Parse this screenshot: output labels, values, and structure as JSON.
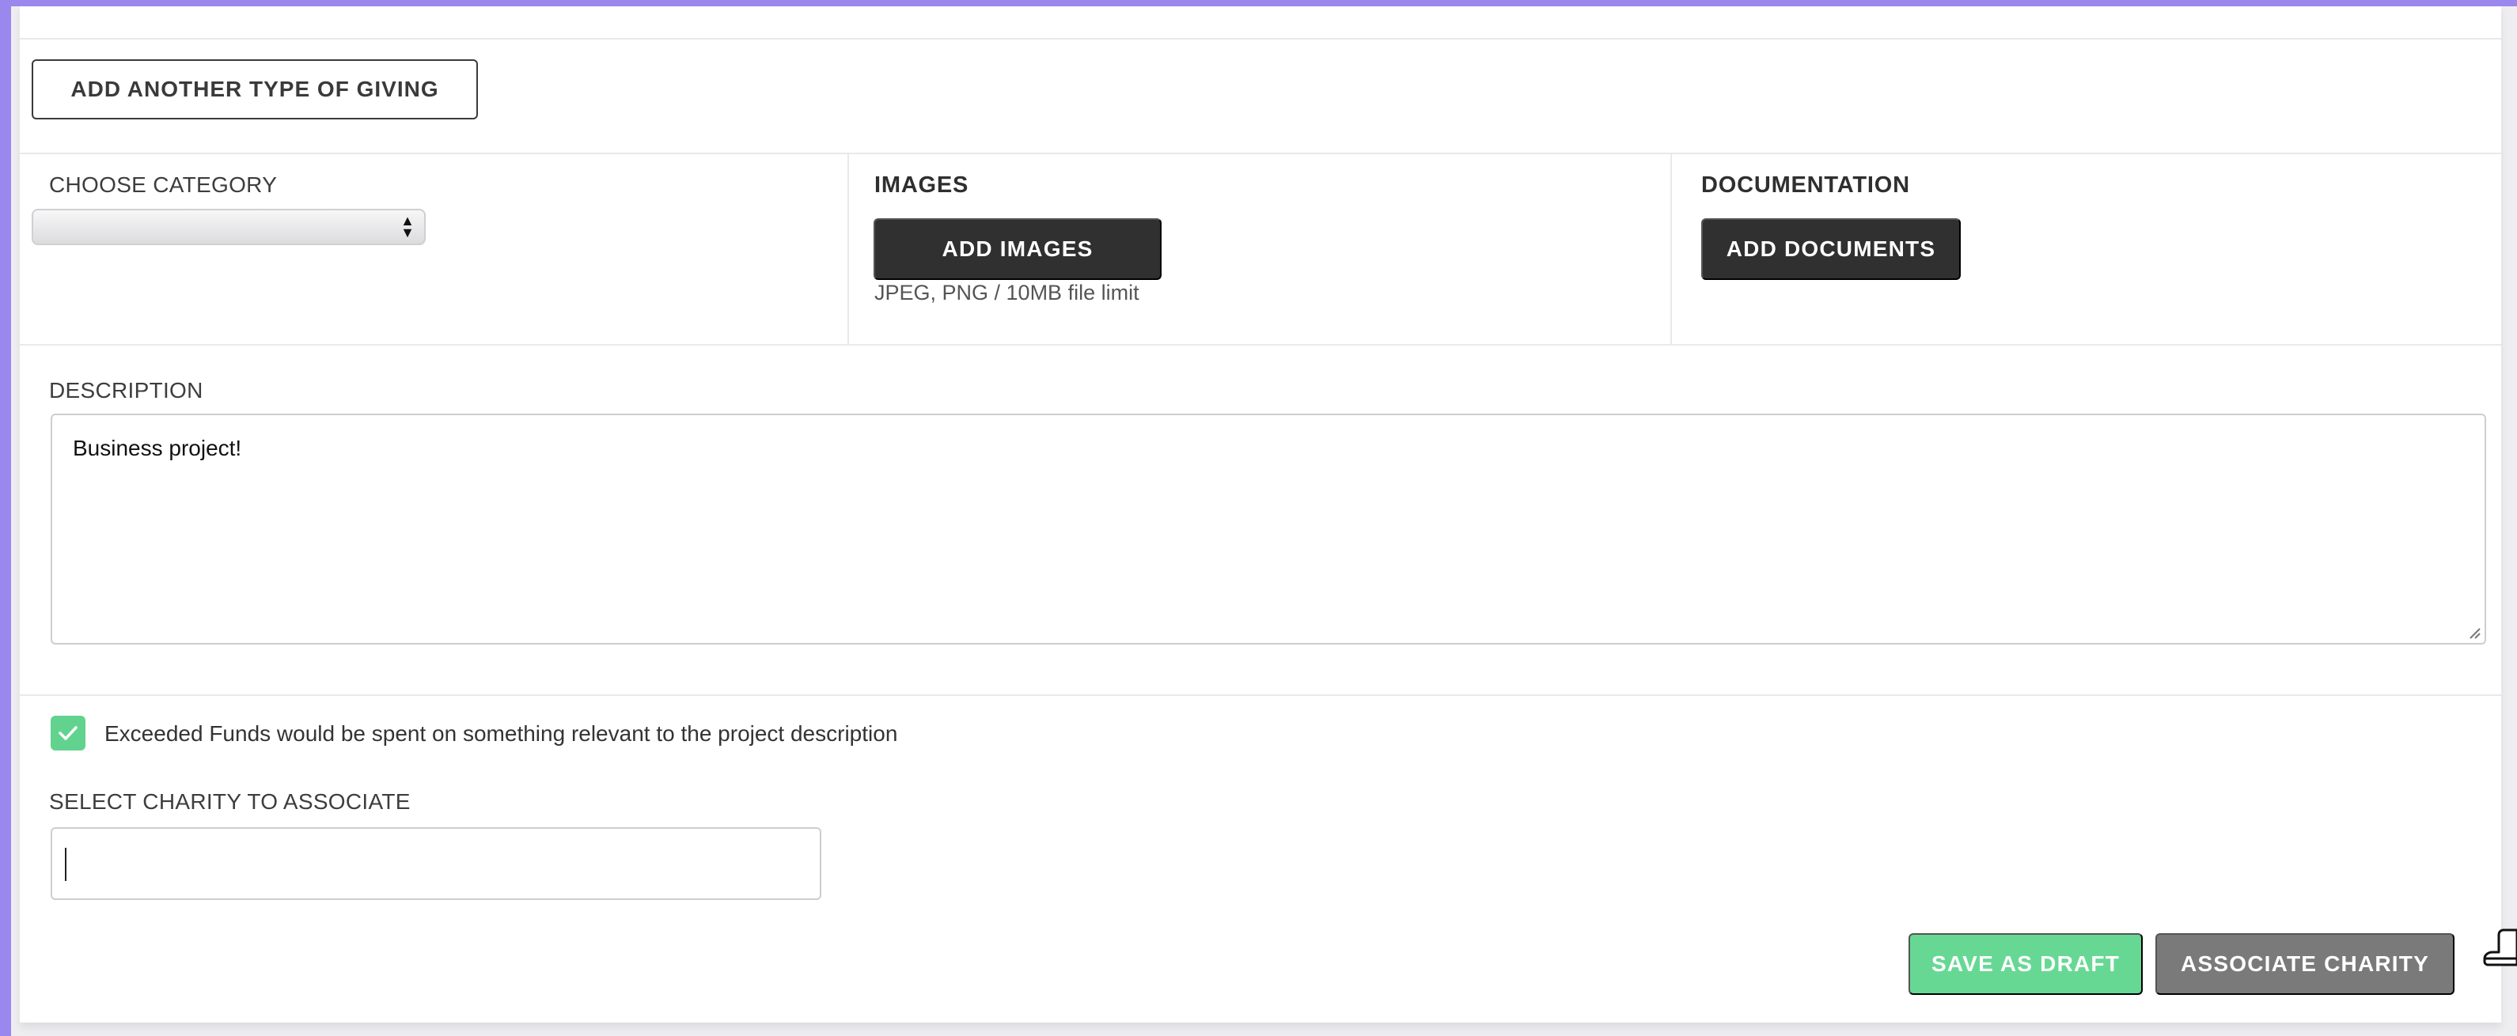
{
  "giving": {
    "add_another_label": "ADD ANOTHER TYPE OF GIVING"
  },
  "category": {
    "label": "CHOOSE CATEGORY",
    "selected": ""
  },
  "images": {
    "heading": "IMAGES",
    "add_button": "ADD IMAGES",
    "hint": "JPEG, PNG / 10MB file limit"
  },
  "documentation": {
    "heading": "DOCUMENTATION",
    "add_button": "ADD DOCUMENTS"
  },
  "description": {
    "label": "DESCRIPTION",
    "value": "Business project!"
  },
  "exceeded_funds": {
    "checked": true,
    "label": "Exceeded Funds would be spent on something relevant to the project description"
  },
  "charity": {
    "label": "SELECT CHARITY TO ASSOCIATE",
    "value": ""
  },
  "actions": {
    "save_draft": "SAVE AS DRAFT",
    "associate": "ASSOCIATE CHARITY"
  },
  "icons": [
    "select-arrows-icon",
    "checkmark-icon",
    "resize-grip-icon",
    "hand-pointer-icon"
  ],
  "colors": {
    "accent_purple": "#9b88ee",
    "dark_button": "#303030",
    "green_button": "#67d894",
    "grey_button": "#7a7a7a",
    "checkbox_green": "#61d38e"
  }
}
